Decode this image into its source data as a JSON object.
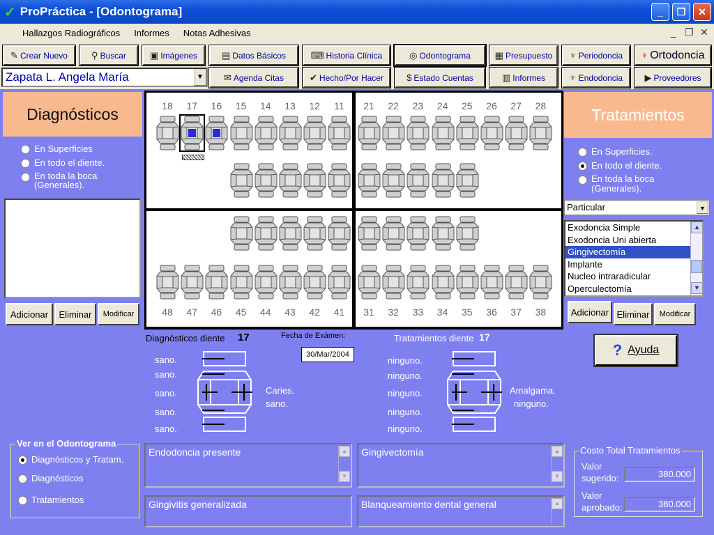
{
  "window": {
    "title": "ProPráctica - [Odontograma]"
  },
  "menu": [
    "Hallazgos Radiográficos",
    "Informes",
    "Notas Adhesivas"
  ],
  "toolbar": {
    "crear": "Crear Nuevo",
    "buscar": "Buscar",
    "imagenes": "Imágenes",
    "datos": "Datos Básicos",
    "historia": "Historia Clínica",
    "odontograma": "Odontograma",
    "presupuesto": "Presupuesto",
    "periodoncia": "Periodoncia",
    "ortodoncia": "Ortodoncia",
    "agenda": "Agenda Citas",
    "hecho": "Hecho/Por Hacer",
    "estado": "Estado Cuentas",
    "informes": "Informes",
    "endodoncia": "Endodoncia",
    "proveedores": "Proveedores"
  },
  "patient": {
    "name": "Zapata L. Angela María"
  },
  "diagnosticos": {
    "title": "Diagnósticos",
    "options": [
      "En Superficies",
      "En todo el diente.",
      "En toda la boca (Generales)."
    ],
    "buttons": {
      "add": "Adicionar",
      "del": "Eliminar",
      "mod": "Modificar"
    }
  },
  "tratamientos": {
    "title": "Tratamientos",
    "options": [
      "En Superficies.",
      "En todo el diente.",
      "En toda la boca (Generales)."
    ],
    "selected_option": 1,
    "select_value": "Particular",
    "items": [
      "Exodoncia Simple",
      "Exodoncia Uni abierta",
      "Gingivectomía",
      "Implante",
      "Nucleo intraradicular",
      "Operculectomía"
    ],
    "selected_item": 2,
    "buttons": {
      "add": "Adicionar",
      "del": "Eliminar",
      "mod": "Modificar"
    }
  },
  "teeth": {
    "upper_right": [
      "18",
      "17",
      "16",
      "15",
      "14",
      "13",
      "12",
      "11"
    ],
    "upper_left": [
      "21",
      "22",
      "23",
      "24",
      "25",
      "26",
      "27",
      "28"
    ],
    "lower_right": [
      "48",
      "47",
      "46",
      "45",
      "44",
      "43",
      "42",
      "41"
    ],
    "lower_left": [
      "31",
      "32",
      "33",
      "34",
      "35",
      "36",
      "37",
      "38"
    ],
    "marked_teeth": [
      "17",
      "16"
    ]
  },
  "detail": {
    "diag_label": "Diagnósticos diente",
    "diag_tooth": "17",
    "fecha_label": "Fecha de Exámen:",
    "fecha": "30/Mar/2004",
    "trat_label": "Tratamientos diente",
    "trat_tooth": "17",
    "diag_surfaces": [
      "sano.",
      "sano.",
      "sano.",
      "sano.",
      "sano."
    ],
    "diag_whole": "Caries.",
    "diag_whole2": "sano.",
    "trat_surfaces": [
      "ninguno.",
      "ninguno.",
      "ninguno.",
      "ninguno.",
      "ninguno."
    ],
    "trat_whole": "Amalgama.",
    "trat_whole2": "ninguno."
  },
  "ayuda": "Ayuda",
  "ver": {
    "title": "Ver en el Odontograma",
    "options": [
      "Diagnósticos y Tratam.",
      "Diagnósticos",
      "Tratamientos"
    ],
    "selected": 0
  },
  "boxes": {
    "endo": "Endodoncia presente",
    "gingivitis": "Gingivitis generalizada",
    "gingivectomia": "Gingivectomía",
    "blanqueamiento": "Blanqueamiento dental general"
  },
  "costo": {
    "title": "Costo Total Tratamientos",
    "sugerido_label1": "Valor",
    "sugerido_label2": "sugerido:",
    "sugerido": "380.000",
    "aprobado_label1": "Valor",
    "aprobado_label2": "aprobado:",
    "aprobado": "380.000"
  },
  "colors": {
    "panel": "#7f80f0",
    "accent": "#f9b98f",
    "marker": "#2a2ad8"
  }
}
